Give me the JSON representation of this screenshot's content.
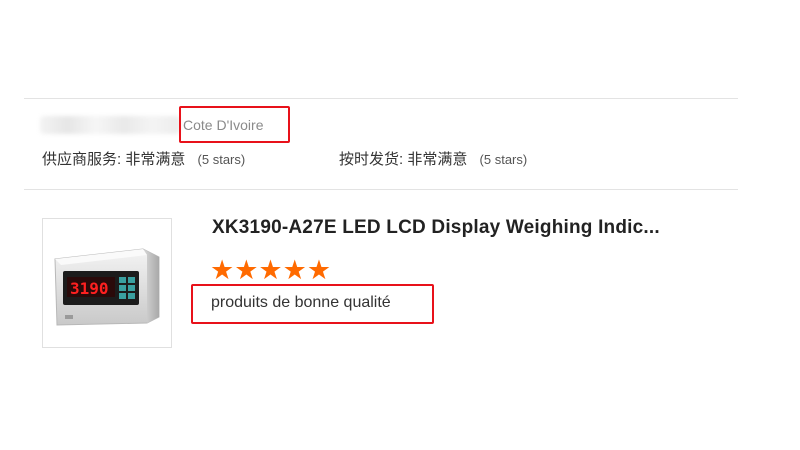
{
  "review_header": {
    "country": "Cote D'Ivoire",
    "supplier_service": {
      "label": "供应商服务:",
      "value": "非常满意",
      "stars_text": "(5 stars)"
    },
    "on_time_delivery": {
      "label": "按时发货:",
      "value": "非常满意",
      "stars_text": "(5 stars)"
    }
  },
  "product": {
    "title": "XK3190-A27E LED LCD Display Weighing Indic...",
    "image_icon": "weighing-indicator-image",
    "display_digits": "3190",
    "rating": 5,
    "stars": "★★★★★",
    "review_text": "produits de bonne qualité"
  },
  "colors": {
    "highlight": "#e8111a",
    "star": "#ff6a00",
    "divider": "#e3e3e3"
  }
}
